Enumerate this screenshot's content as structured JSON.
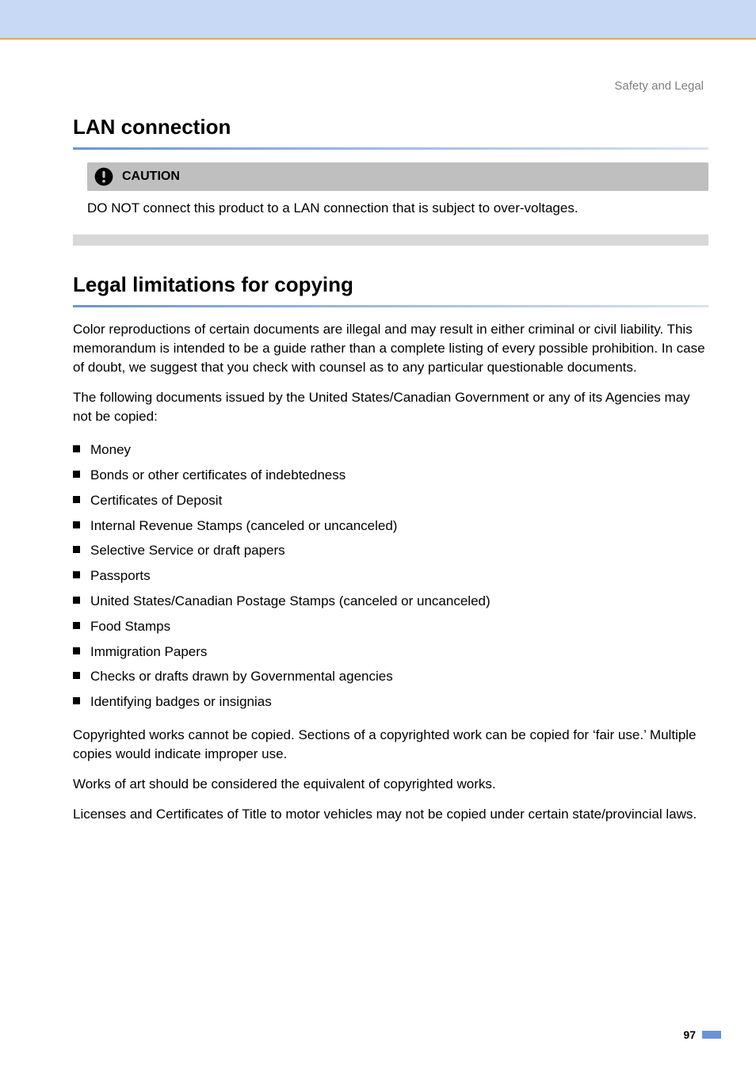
{
  "breadcrumb": "Safety and Legal",
  "lan": {
    "title": "LAN connection",
    "caution_label": "CAUTION",
    "caution_text": "DO NOT connect this product to a LAN connection that is subject to over-voltages."
  },
  "legal": {
    "title": "Legal limitations for copying",
    "intro": "Color reproductions of certain documents are illegal and may result in either criminal or civil liability. This memorandum is intended to be a guide rather than a complete listing of every possible prohibition. In case of doubt, we suggest that you check with counsel as to any particular questionable documents.",
    "para2": "The following documents issued by the United States/Canadian Government or any of its Agencies may not be copied:",
    "items": [
      "Money",
      "Bonds or other certificates of indebtedness",
      "Certificates of Deposit",
      "Internal Revenue Stamps (canceled or uncanceled)",
      "Selective Service or draft papers",
      "Passports",
      "United States/Canadian Postage Stamps (canceled or uncanceled)",
      "Food Stamps",
      "Immigration Papers",
      "Checks or drafts drawn by Governmental agencies",
      "Identifying badges or insignias"
    ],
    "para3": "Copyrighted works cannot be copied. Sections of a copyrighted work can be copied for ‘fair use.’ Multiple copies would indicate improper use.",
    "para4": "Works of art should be considered the equivalent of copyrighted works.",
    "para5": "Licenses and Certificates of Title to motor vehicles may not be copied under certain state/provincial laws."
  },
  "page_number": "97"
}
